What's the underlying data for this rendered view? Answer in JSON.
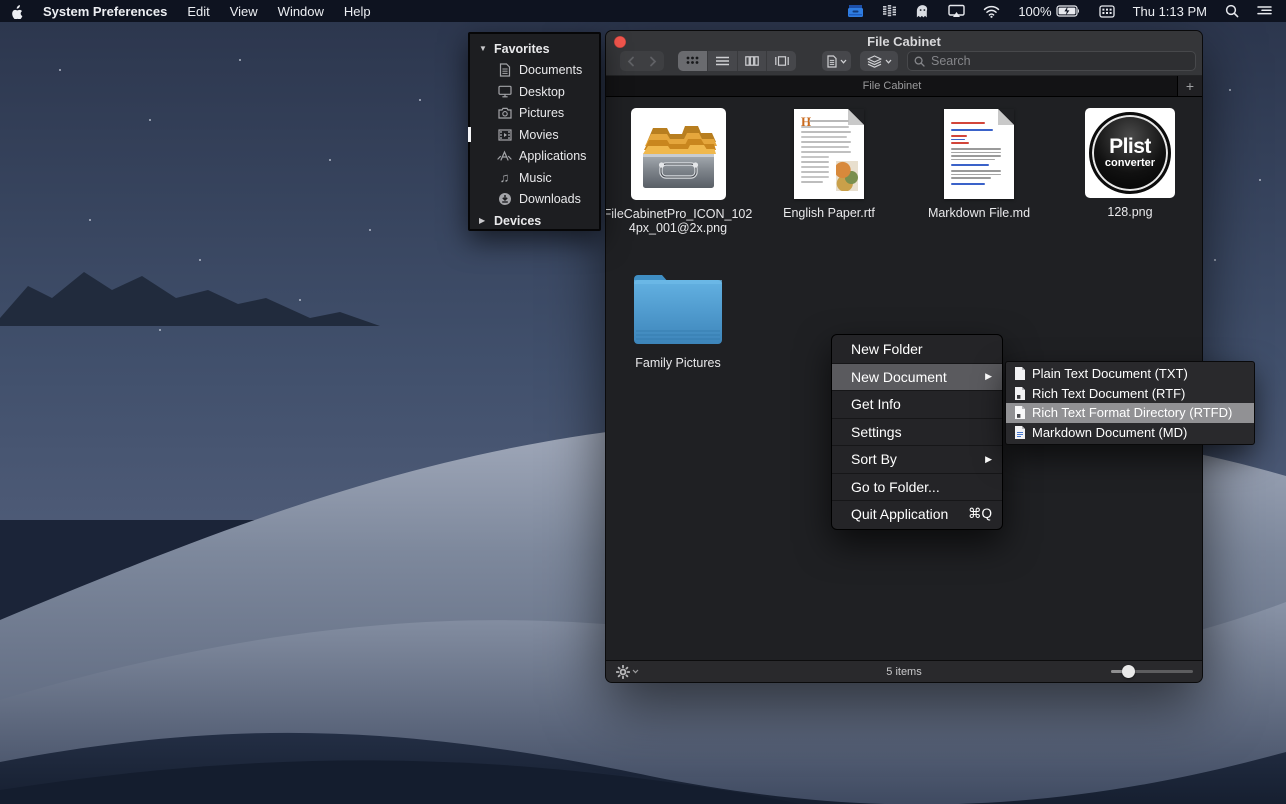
{
  "icons": {
    "disclosure_down": "▼",
    "disclosure_right": "▶",
    "submenu_arrow": "▶",
    "music_note": "♫",
    "plus": "+"
  },
  "menu_bar": {
    "app_name": "System Preferences",
    "menus": [
      "Edit",
      "View",
      "Window",
      "Help"
    ],
    "battery_percent": "100%",
    "clock": "Thu 1:13 PM"
  },
  "sidebar": {
    "favorites_label": "Favorites",
    "devices_label": "Devices",
    "items": [
      {
        "label": "Documents"
      },
      {
        "label": "Desktop"
      },
      {
        "label": "Pictures"
      },
      {
        "label": "Movies"
      },
      {
        "label": "Applications"
      },
      {
        "label": "Music"
      },
      {
        "label": "Downloads"
      }
    ]
  },
  "window": {
    "title": "File Cabinet",
    "tab_title": "File Cabinet",
    "search_placeholder": "Search",
    "files": [
      {
        "name": "FileCabinetPro_ICON_1024px_001@2x.png"
      },
      {
        "name": "English Paper.rtf"
      },
      {
        "name": "Markdown File.md"
      },
      {
        "name": "128.png",
        "badge_line1": "Plist",
        "badge_line2": "converter"
      },
      {
        "name": "Family Pictures"
      }
    ],
    "items_count": "5 items"
  },
  "context_menu": {
    "items": [
      {
        "label": "New Folder"
      },
      {
        "label": "New Document"
      },
      {
        "label": "Get Info"
      },
      {
        "label": "Settings"
      },
      {
        "label": "Sort By"
      },
      {
        "label": "Go to Folder..."
      },
      {
        "label": "Quit Application",
        "shortcut": "⌘Q"
      }
    ]
  },
  "submenu": {
    "items": [
      {
        "label": "Plain Text Document (TXT)"
      },
      {
        "label": "Rich Text Document (RTF)"
      },
      {
        "label": "Rich Text Format Directory (RTFD)"
      },
      {
        "label": "Markdown Document (MD)"
      }
    ]
  },
  "colors": {
    "accent_blue": "#2f7de1",
    "folder_blue": "#55a7dc",
    "close_red": "#f2564d",
    "menu_highlight": "#5a5a5e",
    "submenu_highlight": "#919194"
  }
}
